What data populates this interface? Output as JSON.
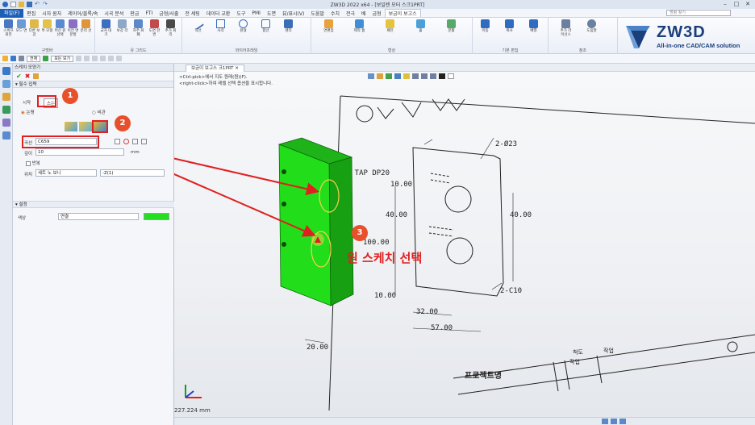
{
  "window": {
    "title": "ZW3D 2022 x64 - [보일렌 모터 스크1PRT]",
    "minimize": "–",
    "maximize": "□",
    "close": "✕"
  },
  "menubar": {
    "file_label": "파일(F)",
    "tabs": [
      "편집",
      "시자 원자",
      "레이어/블록/속",
      "시곡 분석",
      "판금",
      "FTI",
      "금형/사출",
      "전 세팅",
      "데이터 교환",
      "도구",
      "PMI",
      "도면",
      "뷰/표시(V)",
      "도움말",
      "수치",
      "전극",
      "배",
      "금형",
      "보금이 보고스"
    ],
    "active_tab": "보금이 보고스",
    "search_placeholder": "명령 찾기"
  },
  "ribbon": {
    "groups": [
      {
        "label": "구멍바",
        "buttons": [
          "스위프 회전",
          "모드 면",
          "다른 보강",
          "특 모형",
          "머신 원 선택",
          "이전 면분할",
          "분리 선 "
        ]
      },
      {
        "label": "유 그리드",
        "buttons": [
          "교자 대기",
          "보강 각",
          "자주 화폐",
          "도면 한번",
          "추가 회리"
        ]
      },
      {
        "label": "와이어프레임",
        "buttons": [
          "직선",
          "사각",
          "원형",
          "합선",
          "렌더"
        ]
      },
      {
        "label": "형상",
        "buttons": [
          "면편집",
          "제작 품",
          "패턴",
          "홀",
          "분활"
        ]
      },
      {
        "label": "기본 편집",
        "buttons": [
          "이동",
          "복사",
          "배열"
        ]
      },
      {
        "label": "참조",
        "buttons": [
          "추가 라이선스",
          "도움말"
        ]
      }
    ]
  },
  "brand": {
    "name": "ZW3D",
    "tagline": "All-in-one CAD/CAM solution"
  },
  "toolbar2": {
    "filter_label": "전체",
    "view_label": "모든 보기"
  },
  "panel": {
    "title": "스케치 모양기",
    "section_main": "▾ 필수 입력",
    "tab_left": "시작",
    "tab_right": "스는",
    "radio_left": "논평",
    "radio_right": "비관",
    "field_profile_label": "곡선",
    "field_profile_value": "C659",
    "field_length_label": "깊이",
    "field_length_value": "10",
    "field_length_unit": "mm",
    "check_label": "반복",
    "field_pos_label": "위치",
    "field_pos_value": "세트 노 보니",
    "field_pos_right": "-Z(1)",
    "section_setting": "▾ 설정",
    "color_label": "색상",
    "color_value": "연결",
    "swatch_color": "#22e01e"
  },
  "document": {
    "tab_label": "보금이 보고스 크1PRT",
    "hint1": "<Ctrl-pick>에서 지도 원래(원)(F).",
    "hint2": "<right-click>하여 레벨 선택 옵션을 표시합니다."
  },
  "annotations": {
    "badge1": "1",
    "badge2": "2",
    "badge3": "3",
    "caption": "원 스케치 선택"
  },
  "drawing": {
    "callout_tap": "M10 TAP DP20",
    "callout_hole": "2-Ø23",
    "callout_chamfer": "2-C10",
    "dim_10a": "10.00",
    "dim_40a": "40.00",
    "dim_40b": "40.00",
    "dim_100": "100.00",
    "dim_10b": "10.00",
    "dim_32": "32.00",
    "dim_57": "57.00",
    "dim_20": "20.00",
    "title_project": "프로젝트명",
    "title_scale": "척도",
    "title_drawn": "작업",
    "title_author": "작업",
    "surface_mark": "①",
    "distance_readout": "227.224 mm"
  },
  "colors": {
    "accent": "#1d5fb5",
    "green_part": "#22dd1a",
    "callout_red": "#e02020",
    "badge": "#e8502c"
  }
}
